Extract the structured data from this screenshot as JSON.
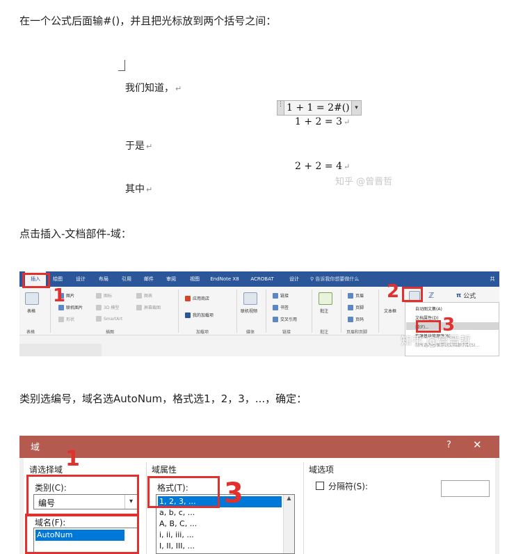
{
  "article": {
    "step1_text": "在一个公式后面输#()，并且把光标放到两个括号之间：",
    "step2_text": "点击插入-文档部件-域：",
    "step3_text": "类别选编号，域名选AutoNum，格式选1，2，3，...，确定："
  },
  "doc": {
    "line1": "我们知道，",
    "eq1": "1 + 1 = 2#()",
    "eq2": "1 + 2 = 3",
    "line2": "于是",
    "eq3": "2 + 2 = 4",
    "line3": "其中",
    "pilcrow": "↵",
    "watermark": "知乎 @曾晋哲"
  },
  "ribbon": {
    "tabs": [
      "插入",
      "绘图",
      "设计",
      "布局",
      "引用",
      "邮件",
      "审阅",
      "视图",
      "EndNote X8",
      "ACROBAT",
      "设计"
    ],
    "search_placeholder": "告诉我你想要做什么",
    "share": "共",
    "tables_group": {
      "item": "表格",
      "label": "表格"
    },
    "illustrations": {
      "pictures": "图片",
      "online_pictures": "联机图片",
      "shapes": "形状",
      "icons": "图标",
      "models_3d": "3D 模型",
      "smartart": "SmartArt",
      "chart": "图表",
      "screenshot": "屏幕截图",
      "label": "插图"
    },
    "addins": {
      "store": "应用商店",
      "my_addins": "我的加载项",
      "label": "加载项"
    },
    "media": {
      "online_video": "联机视频",
      "label": "媒体"
    },
    "links": {
      "link": "链接",
      "bookmark": "书签",
      "cross_ref": "交叉引用",
      "label": "链接"
    },
    "comments": {
      "comment": "批注",
      "label": "批注"
    },
    "header_footer": {
      "header": "页眉",
      "footer": "页脚",
      "page_number": "页码",
      "label": "页眉和页脚"
    },
    "text_group": {
      "textbox": "文本框"
    },
    "equation": {
      "symbol": "π",
      "label": "公式"
    },
    "quick_parts_menu": [
      "自动图文集(A)",
      "文档属性(D)",
      "域(F)...",
      "构建基块管理器(B)...",
      "将所选内容保存到文档部件库(S)..."
    ],
    "annotations": [
      "1",
      "2",
      "3"
    ],
    "watermark": "知乎 @曾晋哲"
  },
  "dialog": {
    "title": "域",
    "help": "?",
    "close": "✕",
    "choose_field_header": "请选择域",
    "categories_label": "类别(C):",
    "category_value": "编号",
    "field_names_label": "域名(F):",
    "field_name_value": "AutoNum",
    "field_props_header": "域属性",
    "format_label": "格式(T):",
    "formats": [
      "1, 2, 3, ...",
      "a, b, c, ...",
      "A, B, C, ...",
      "i, ii, iii, ...",
      "I, II, III, ..."
    ],
    "field_options_header": "域选项",
    "separator_label": "分隔符(S):",
    "annotations": [
      "1",
      "2",
      "3"
    ]
  }
}
